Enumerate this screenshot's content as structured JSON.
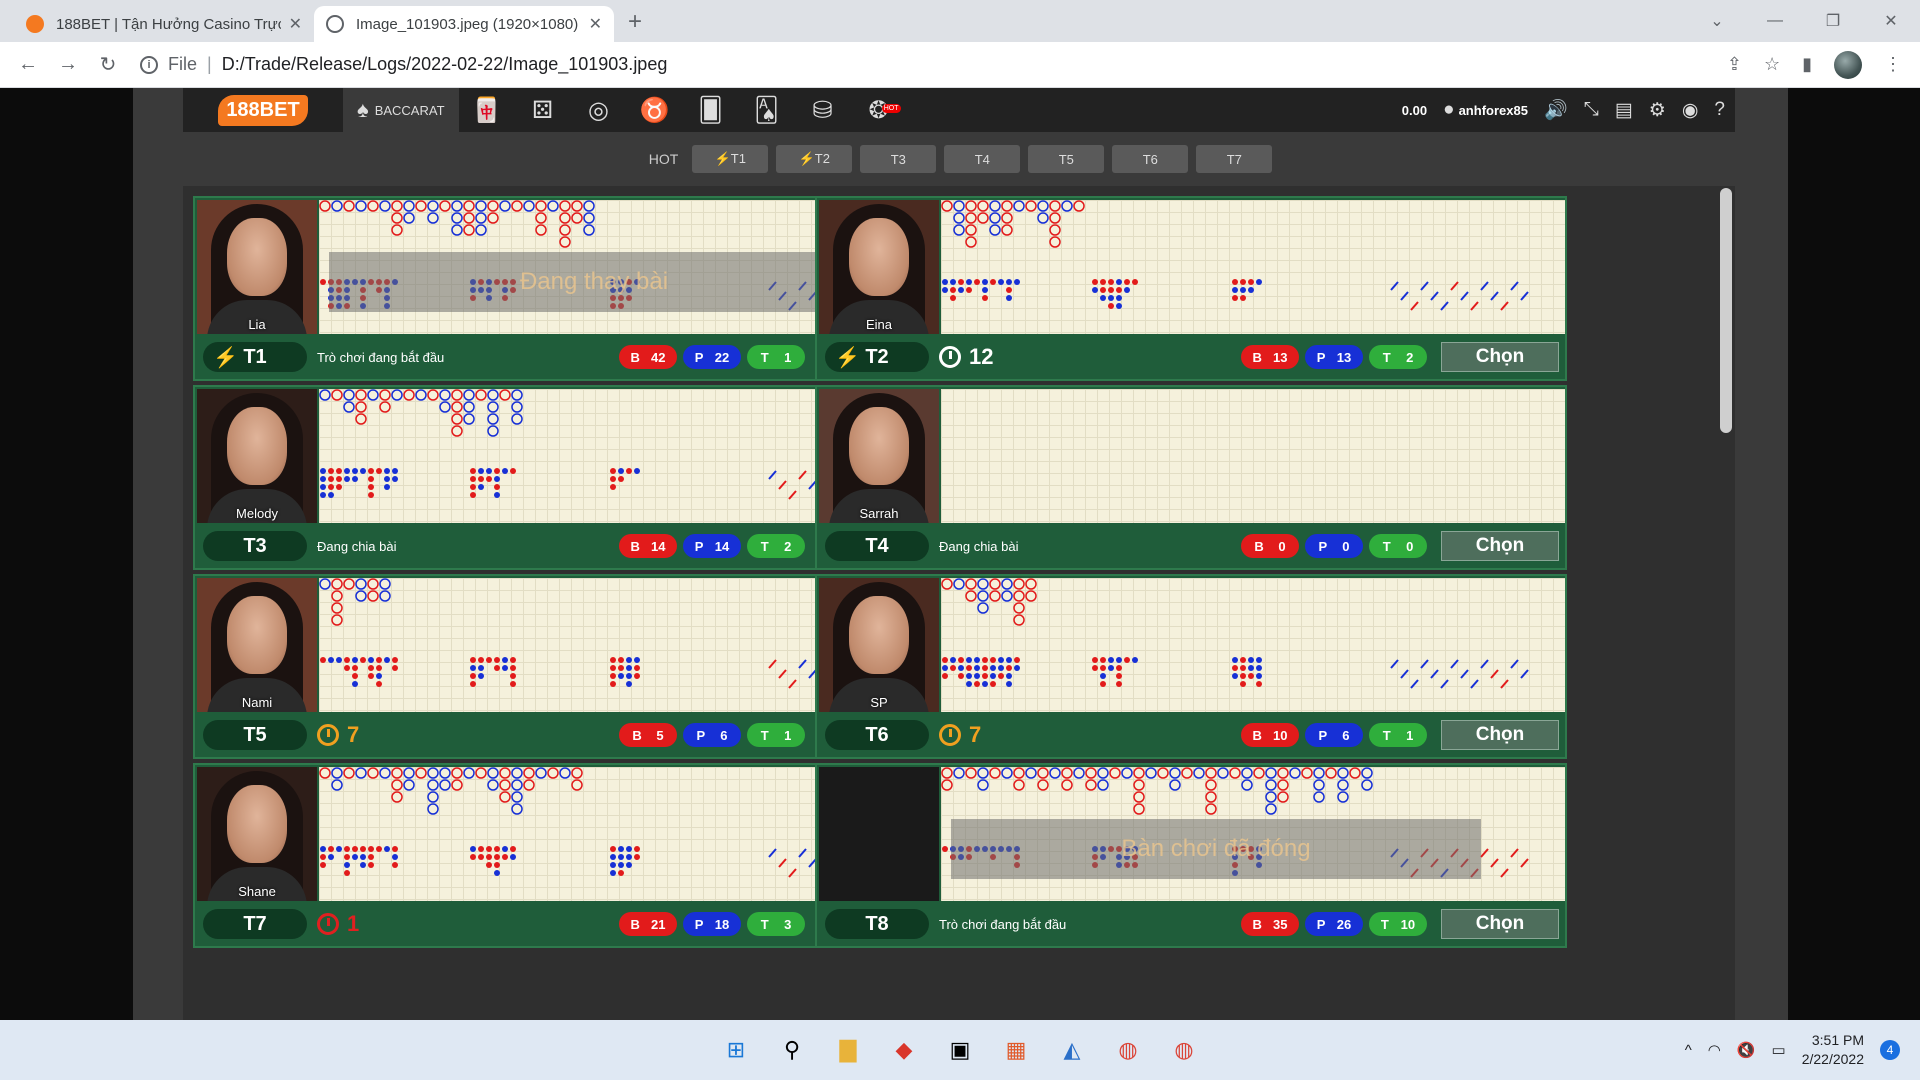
{
  "browser": {
    "tabs": [
      {
        "title": "188BET | Tận Hưởng Casino Trực",
        "favicon_color": "#f47920",
        "active": false
      },
      {
        "title": "Image_101903.jpeg (1920×1080)",
        "favicon_color": "#5f6368",
        "active": true
      }
    ],
    "new_tab": "+",
    "url_scheme": "File",
    "url": "D:/Trade/Release/Logs/2022-02-22/Image_101903.jpeg"
  },
  "site": {
    "logo": "188BET",
    "nav_active": "BACCARAT",
    "balance": "0.00",
    "username": "anhforex85",
    "hot_badge": "HOT",
    "hot_label": "HOT",
    "hot_filters": [
      "⚡T1",
      "⚡T2",
      "T3",
      "T4",
      "T5",
      "T6",
      "T7"
    ]
  },
  "choose_label": "Chọn",
  "cards": [
    {
      "dealer": "Lia",
      "table": "T1",
      "bolt": true,
      "status": "Trò chơi đang bắt đầu",
      "timer": "",
      "b": "42",
      "p": "22",
      "t": "1",
      "overlay": "Đang thay bài"
    },
    {
      "dealer": "Eina",
      "table": "T2",
      "bolt": true,
      "status": "",
      "timer": "12",
      "timer_color": "#ffffff",
      "b": "13",
      "p": "13",
      "t": "2",
      "overlay": ""
    },
    {
      "dealer": "Melody",
      "table": "T3",
      "bolt": false,
      "status": "Đang chia bài",
      "timer": "",
      "b": "14",
      "p": "14",
      "t": "2",
      "overlay": ""
    },
    {
      "dealer": "Sarrah",
      "table": "T4",
      "bolt": false,
      "status": "Đang chia bài",
      "timer": "",
      "b": "0",
      "p": "0",
      "t": "0",
      "overlay": ""
    },
    {
      "dealer": "Nami",
      "table": "T5",
      "bolt": false,
      "status": "",
      "timer": "7",
      "timer_color": "#f0a020",
      "b": "5",
      "p": "6",
      "t": "1",
      "overlay": ""
    },
    {
      "dealer": "SP",
      "table": "T6",
      "bolt": false,
      "status": "",
      "timer": "7",
      "timer_color": "#f0a020",
      "b": "10",
      "p": "6",
      "t": "1",
      "overlay": ""
    },
    {
      "dealer": "Shane",
      "table": "T7",
      "bolt": false,
      "status": "",
      "timer": "1",
      "timer_color": "#e02020",
      "b": "21",
      "p": "18",
      "t": "3",
      "overlay": ""
    },
    {
      "dealer": "",
      "table": "T8",
      "bolt": false,
      "status": "Trò chơi đang bắt đầu",
      "timer": "",
      "b": "35",
      "p": "26",
      "t": "10",
      "overlay": "Bàn chơi đã đóng"
    }
  ],
  "taskbar": {
    "time": "3:51 PM",
    "date": "2/22/2022",
    "notifications": "4"
  },
  "colors": {
    "banker": "#e21b1b",
    "player": "#1730d6",
    "tie": "#2fae3c",
    "card_green": "#1f5d3a"
  }
}
